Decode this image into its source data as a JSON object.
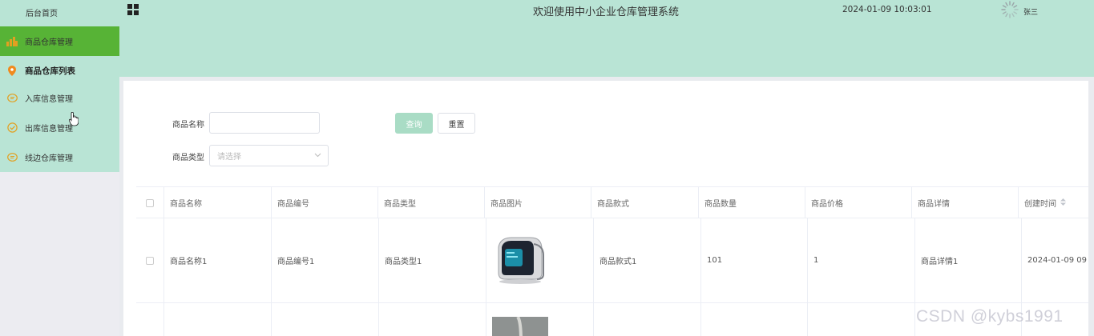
{
  "sidebar": {
    "home_label": "后台首页",
    "items": [
      {
        "label": "商品仓库管理",
        "icon": "chart-bar-icon",
        "active": true
      },
      {
        "label": "商品仓库列表",
        "icon": "location-pin-icon",
        "sub": true
      },
      {
        "label": "入库信息管理",
        "icon": "chat-bubble-icon"
      },
      {
        "label": "出库信息管理",
        "icon": "check-circle-icon"
      },
      {
        "label": "线边仓库管理",
        "icon": "chat-bubble-icon"
      }
    ]
  },
  "header": {
    "title": "欢迎使用中小企业仓库管理系统",
    "datetime": "2024-01-09 10:03:01",
    "user": "张三"
  },
  "search": {
    "name_label": "商品名称",
    "name_value": "",
    "type_label": "商品类型",
    "type_placeholder": "请选择",
    "query_label": "查询",
    "reset_label": "重置"
  },
  "table": {
    "columns": [
      "商品名称",
      "商品编号",
      "商品类型",
      "商品图片",
      "商品款式",
      "商品数量",
      "商品价格",
      "商品详情",
      "创建时间"
    ],
    "rows": [
      {
        "name": "商品名称1",
        "code": "商品编号1",
        "type": "商品类型1",
        "style": "商品款式1",
        "qty": "101",
        "price": "1",
        "detail": "商品详情1",
        "created": "2024-01-09 09"
      }
    ]
  },
  "colors": {
    "header_bg": "#b9e4d5",
    "active_menu": "#57b336",
    "query_button": "#a9dcc5"
  },
  "watermark": "CSDN @kybs1991"
}
